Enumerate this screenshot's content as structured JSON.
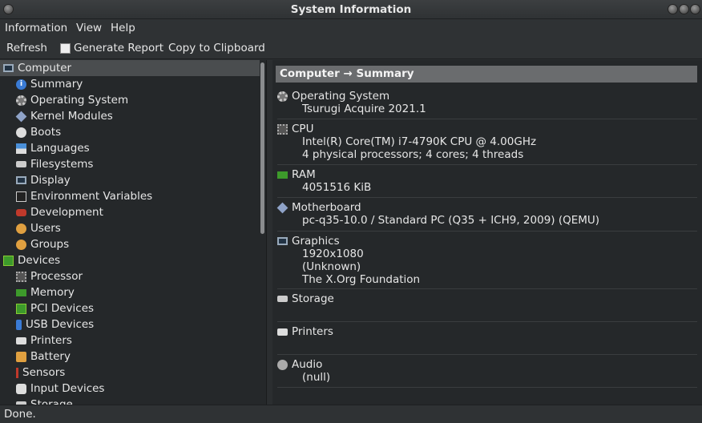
{
  "window": {
    "title": "System Information"
  },
  "menu": [
    "Information",
    "View",
    "Help"
  ],
  "toolbar": {
    "refresh": "Refresh",
    "generate_report": "Generate Report",
    "copy": "Copy to Clipboard"
  },
  "tree": [
    {
      "label": "Computer",
      "icon": "monitor-icon",
      "level": 0,
      "selected": true
    },
    {
      "label": "Summary",
      "icon": "info-icon",
      "level": 1
    },
    {
      "label": "Operating System",
      "icon": "gear-icon",
      "level": 1
    },
    {
      "label": "Kernel Modules",
      "icon": "diamond-icon",
      "level": 1
    },
    {
      "label": "Boots",
      "icon": "boot-icon",
      "level": 1
    },
    {
      "label": "Languages",
      "icon": "flag-icon",
      "level": 1
    },
    {
      "label": "Filesystems",
      "icon": "disk-icon",
      "level": 1
    },
    {
      "label": "Display",
      "icon": "monitor-icon",
      "level": 1
    },
    {
      "label": "Environment Variables",
      "icon": "terminal-icon",
      "level": 1
    },
    {
      "label": "Development",
      "icon": "development-icon",
      "level": 1
    },
    {
      "label": "Users",
      "icon": "users-icon",
      "level": 1
    },
    {
      "label": "Groups",
      "icon": "users-icon",
      "level": 1
    },
    {
      "label": "Devices",
      "icon": "chip-icon",
      "level": 0
    },
    {
      "label": "Processor",
      "icon": "cpu-icon",
      "level": 1
    },
    {
      "label": "Memory",
      "icon": "memory-icon",
      "level": 1
    },
    {
      "label": "PCI Devices",
      "icon": "chip-icon",
      "level": 1
    },
    {
      "label": "USB Devices",
      "icon": "usb-icon",
      "level": 1
    },
    {
      "label": "Printers",
      "icon": "printer-icon",
      "level": 1
    },
    {
      "label": "Battery",
      "icon": "battery-icon",
      "level": 1
    },
    {
      "label": "Sensors",
      "icon": "sensor-icon",
      "level": 1
    },
    {
      "label": "Input Devices",
      "icon": "input-icon",
      "level": 1
    },
    {
      "label": "Storage",
      "icon": "disk-icon",
      "level": 1
    }
  ],
  "content": {
    "header": "Computer → Summary",
    "sections": [
      {
        "title": "Operating System",
        "icon": "gear-icon",
        "values": [
          "Tsurugi Acquire 2021.1"
        ]
      },
      {
        "title": "CPU",
        "icon": "cpu-icon",
        "values": [
          "Intel(R) Core(TM) i7-4790K CPU @ 4.00GHz",
          "4 physical processors; 4 cores; 4 threads"
        ]
      },
      {
        "title": "RAM",
        "icon": "memory-icon",
        "values": [
          "4051516 KiB"
        ]
      },
      {
        "title": "Motherboard",
        "icon": "diamond-icon",
        "values": [
          "pc-q35-10.0 / Standard PC (Q35 + ICH9, 2009) (QEMU)"
        ]
      },
      {
        "title": "Graphics",
        "icon": "monitor-icon",
        "values": [
          "1920x1080",
          "(Unknown)",
          "The X.Org Foundation"
        ]
      },
      {
        "title": "Storage",
        "icon": "disk-icon",
        "values": []
      },
      {
        "title": "Printers",
        "icon": "printer-icon",
        "values": []
      },
      {
        "title": "Audio",
        "icon": "audio-icon",
        "values": [
          "(null)"
        ]
      }
    ]
  },
  "status": "Done."
}
